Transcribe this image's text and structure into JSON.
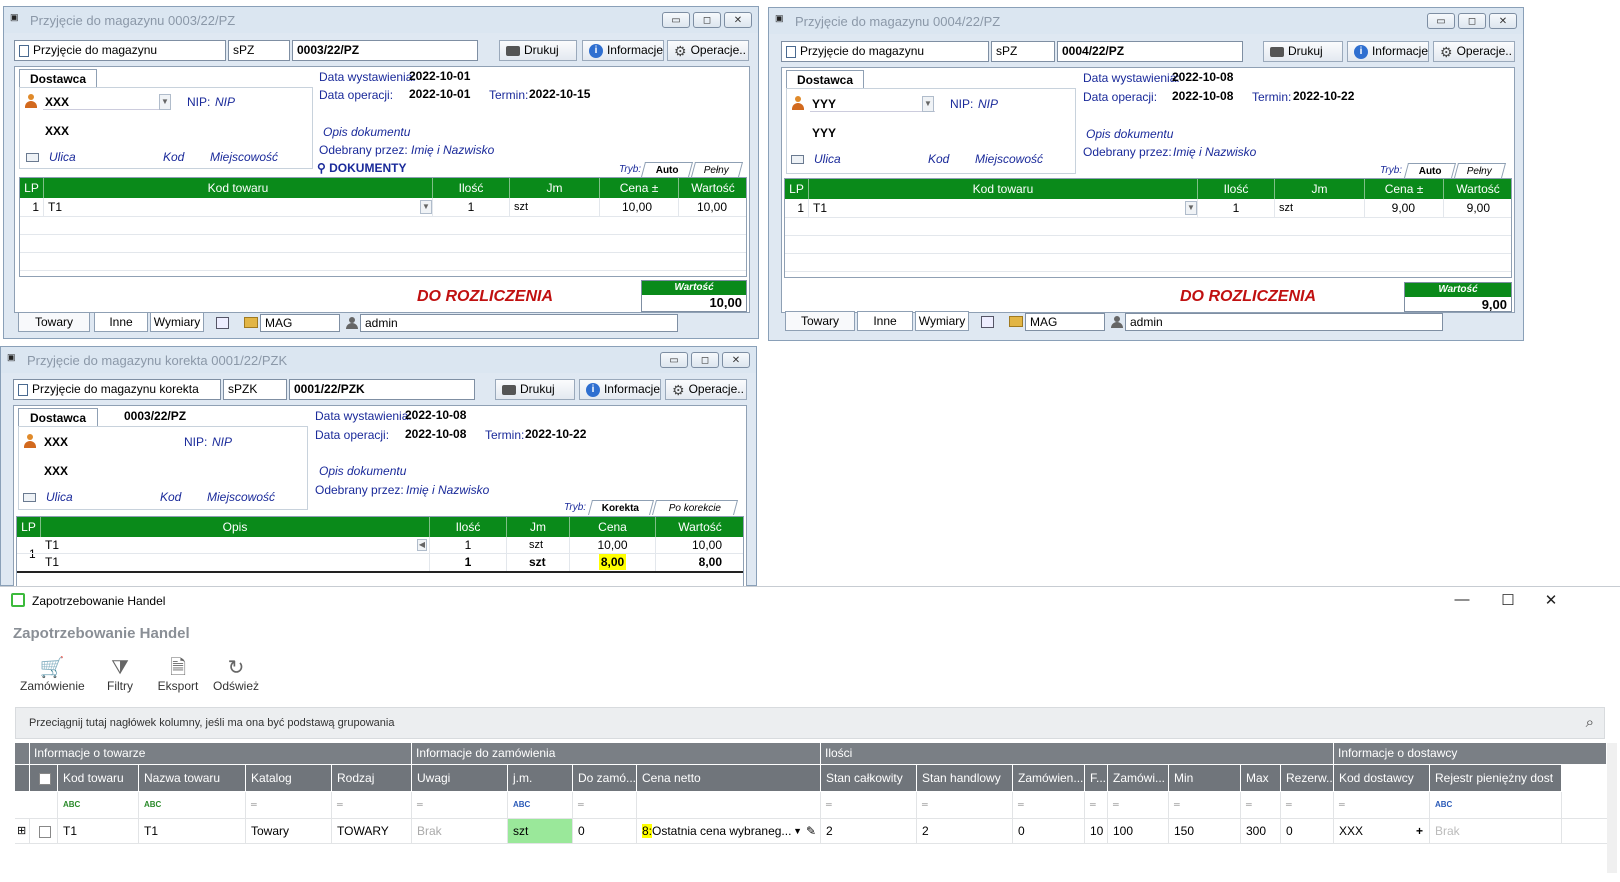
{
  "w1": {
    "title": "Przyjęcie do magazynu 0003/22/PZ",
    "doc_type": "Przyjęcie do magazynu",
    "series": "sPZ",
    "number": "0003/22/PZ",
    "btn_print": "Drukuj",
    "btn_info": "Informacje",
    "btn_ops": "Operacje..",
    "tab_supplier": "Dostawca",
    "supplier_name": "XXX",
    "supplier_name2": "XXX",
    "nip_label": "NIP:",
    "nip_value": "NIP",
    "street": "Ulica",
    "code": "Kod",
    "city": "Miejscowość",
    "issue_label": "Data wystawienia:",
    "issue_date": "2022-10-01",
    "op_label": "Data operacji:",
    "op_date": "2022-10-01",
    "term_label": "Termin:",
    "term_date": "2022-10-15",
    "desc": "Opis dokumentu",
    "received_label": "Odebrany przez:",
    "received_value": "Imię i Nazwisko",
    "docs_label": "DOKUMENTY",
    "tryb": "Tryb:",
    "tryb_tab1": "Auto",
    "tryb_tab2": "Pełny",
    "grid_headers": [
      "LP",
      "Kod towaru",
      "Ilość",
      "Jm",
      "Cena ±",
      "Wartość"
    ],
    "rows": [
      {
        "lp": "1",
        "code": "T1",
        "qty": "1",
        "unit": "szt",
        "price": "10,00",
        "value": "10,00"
      }
    ],
    "status": "DO ROZLICZENIA",
    "total_label": "Wartość",
    "total": "10,00",
    "btab1": "Towary",
    "btab2": "Inne",
    "btab3": "Wymiary",
    "mag": "MAG",
    "user": "admin"
  },
  "w2": {
    "title": "Przyjęcie do magazynu 0004/22/PZ",
    "doc_type": "Przyjęcie do magazynu",
    "series": "sPZ",
    "number": "0004/22/PZ",
    "btn_print": "Drukuj",
    "btn_info": "Informacje",
    "btn_ops": "Operacje..",
    "tab_supplier": "Dostawca",
    "supplier_name": "YYY",
    "supplier_name2": "YYY",
    "nip_label": "NIP:",
    "nip_value": "NIP",
    "street": "Ulica",
    "code": "Kod",
    "city": "Miejscowość",
    "issue_label": "Data wystawienia:",
    "issue_date": "2022-10-08",
    "op_label": "Data operacji:",
    "op_date": "2022-10-08",
    "term_label": "Termin:",
    "term_date": "2022-10-22",
    "desc": "Opis dokumentu",
    "received_label": "Odebrany przez:",
    "received_value": "Imię i Nazwisko",
    "tryb": "Tryb:",
    "tryb_tab1": "Auto",
    "tryb_tab2": "Pełny",
    "grid_headers": [
      "LP",
      "Kod towaru",
      "Ilość",
      "Jm",
      "Cena ±",
      "Wartość"
    ],
    "rows": [
      {
        "lp": "1",
        "code": "T1",
        "qty": "1",
        "unit": "szt",
        "price": "9,00",
        "value": "9,00"
      }
    ],
    "status": "DO ROZLICZENIA",
    "total_label": "Wartość",
    "total": "9,00",
    "btab1": "Towary",
    "btab2": "Inne",
    "btab3": "Wymiary",
    "mag": "MAG",
    "user": "admin"
  },
  "w3": {
    "title": "Przyjęcie do magazynu korekta 0001/22/PZK",
    "doc_type": "Przyjęcie do magazynu korekta",
    "series": "sPZK",
    "number": "0001/22/PZK",
    "btn_print": "Drukuj",
    "btn_info": "Informacje",
    "btn_ops": "Operacje..",
    "tab_supplier": "Dostawca",
    "source_doc": "0003/22/PZ",
    "supplier_name": "XXX",
    "supplier_name2": "XXX",
    "nip_label": "NIP:",
    "nip_value": "NIP",
    "street": "Ulica",
    "code": "Kod",
    "city": "Miejscowość",
    "issue_label": "Data wystawienia:",
    "issue_date": "2022-10-08",
    "op_label": "Data operacji:",
    "op_date": "2022-10-08",
    "term_label": "Termin:",
    "term_date": "2022-10-22",
    "desc": "Opis dokumentu",
    "received_label": "Odebrany przez:",
    "received_value": "Imię i Nazwisko",
    "tryb": "Tryb:",
    "tryb_tab1": "Korekta",
    "tryb_tab2": "Po korekcie",
    "grid_headers": [
      "LP",
      "Opis",
      "Ilość",
      "Jm",
      "Cena",
      "Wartość"
    ],
    "rows": [
      {
        "lp": "1",
        "code": "T1",
        "qty": "1",
        "unit": "szt",
        "price": "10,00",
        "value": "10,00"
      },
      {
        "lp": "",
        "code": "T1",
        "qty": "1",
        "unit": "szt",
        "price": "8,00",
        "value": "8,00"
      }
    ]
  },
  "big": {
    "window_title": "Zapotrzebowanie Handel",
    "header_title": "Zapotrzebowanie Handel",
    "tools": [
      "Zamówienie",
      "Filtry",
      "Eksport",
      "Odśwież"
    ],
    "group_hint": "Przeciągnij tutaj nagłówek kolumny, jeśli ma ona być podstawą grupowania",
    "bands": [
      "Informacje o towarze",
      "Informacje do zamówienia",
      "Ilości",
      "Informacje o dostawcy"
    ],
    "columns": [
      "Kod towaru",
      "Nazwa towaru",
      "Katalog",
      "Rodzaj",
      "Uwagi",
      "j.m.",
      "Do zamó...",
      "Cena netto",
      "Stan całkowity",
      "Stan handlowy",
      "Zamówien...",
      "F...",
      "Zamówi...",
      "Min",
      "Max",
      "Rezerw...",
      "Kod dostawcy",
      "Rejestr pieniężny dost"
    ],
    "filter_tag": "ABC",
    "row": {
      "code": "T1",
      "name": "T1",
      "catalog": "Towary",
      "kind": "TOWARY",
      "notes": "Brak",
      "unit": "szt",
      "to_order": "0",
      "price_num": "8:",
      "price": "Ostatnia cena wybraneg...",
      "stock_total": "2",
      "stock_trade": "2",
      "ordered": "0",
      "f": "10",
      "ordered2": "100",
      "min": "150",
      "max": "300",
      "reserved": "0",
      "supplier": "XXX",
      "register": "Brak"
    }
  },
  "colors": {
    "grid_green": "#0a8a1a",
    "status_red": "#c01010",
    "highlight": "#ffff00",
    "unit_green": "#9ae89a"
  }
}
